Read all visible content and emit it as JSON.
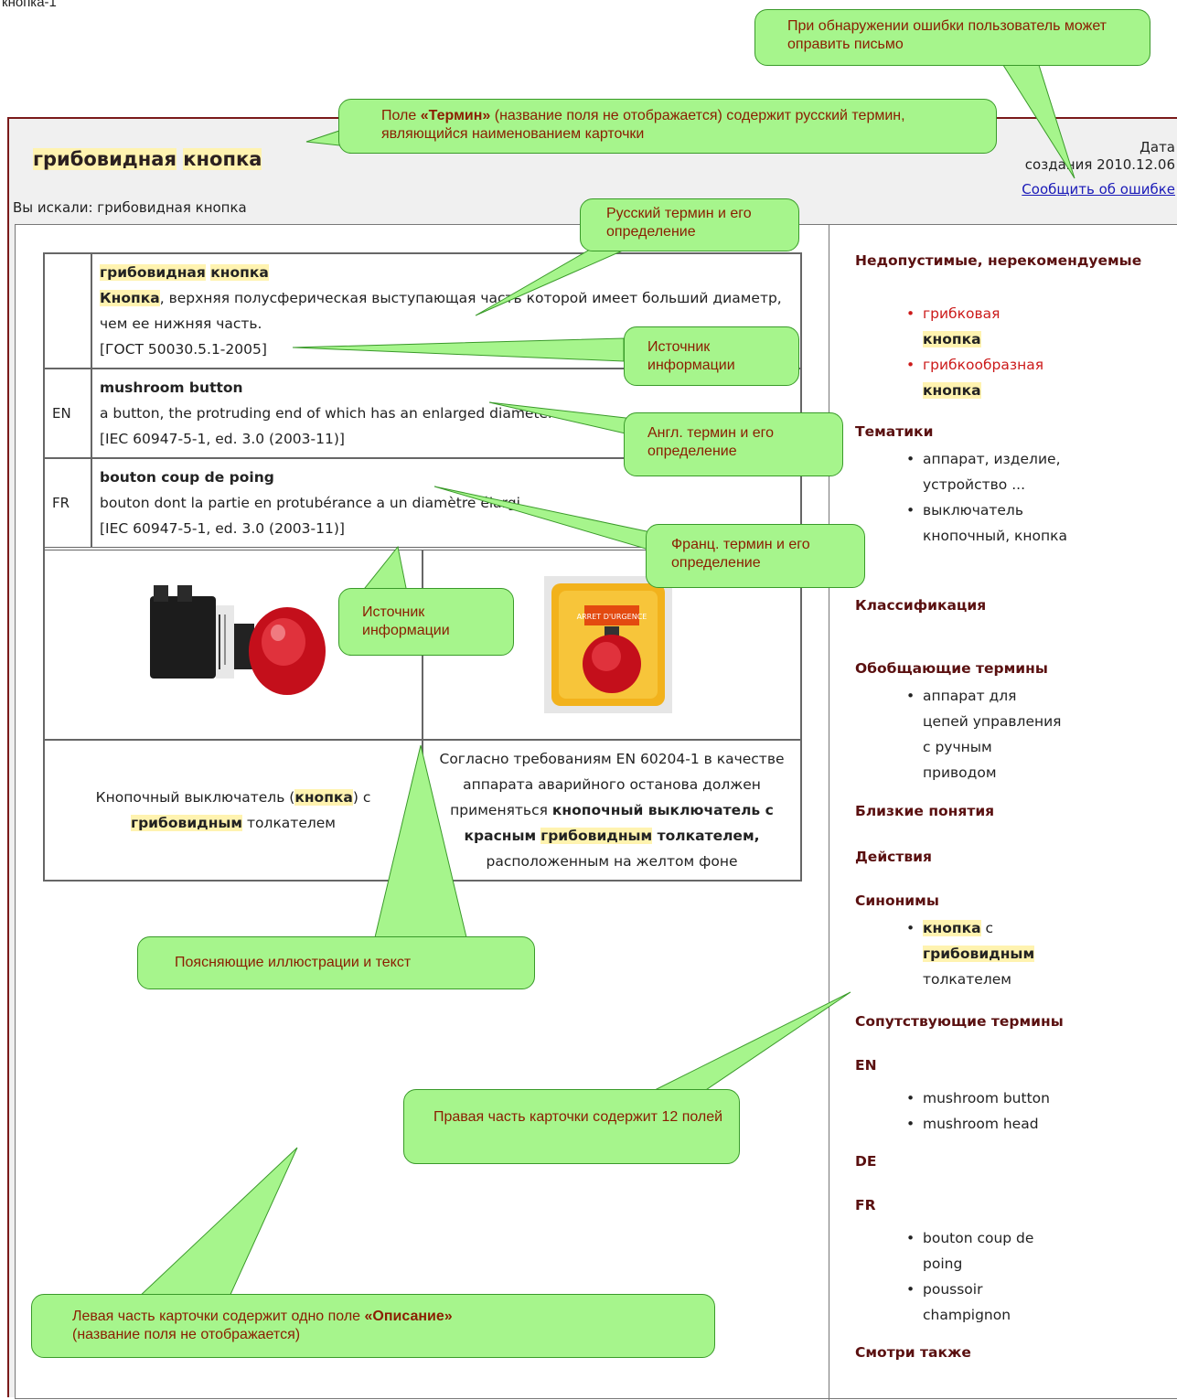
{
  "caption": "кнопка-1",
  "card": {
    "title_part1": "грибовидная",
    "title_part2": "кнопка",
    "date_label": "Дата",
    "date_value": "создания 2010.12.06",
    "report_link": "Сообщить об ошибке",
    "searched": "Вы искали: грибовидная кнопка"
  },
  "definitions": [
    {
      "lang": "",
      "term_a": "грибовидная",
      "term_b": "кнопка",
      "def_bold": "Кнопка",
      "def_rest": ", верхняя полусферическая выступающая часть которой имеет больший диаметр, чем ее нижняя часть.",
      "source": "[ГОСТ 50030.5.1-2005]"
    },
    {
      "lang": "EN",
      "term": "mushroom button",
      "definition": "a button, the protruding end of which has an enlarged diameter",
      "source": "[IEC 60947-5-1, ed. 3.0 (2003-11)]"
    },
    {
      "lang": "FR",
      "term": "bouton coup de poing",
      "definition": "bouton dont la partie en protubérance a un diamètre élargi",
      "source": "[IEC 60947-5-1, ed. 3.0 (2003-11)]"
    }
  ],
  "images": {
    "left_label": "",
    "right_label": "ARRET D'URGENCE"
  },
  "illustration_texts": {
    "left": {
      "p1": "Кнопочный выключатель (",
      "hl1": "кнопка",
      "p2": ") с",
      "hl2": "грибовидным",
      "p3": " толкателем"
    },
    "right": {
      "p1": "Согласно требованиям EN 60204-1 в качестве аппарата аварийного останова должен применяться",
      "b1": "кнопочный выключатель с красным",
      "hl": "грибовидным",
      "b2": " толкателем,",
      "p2": "расположенным на желтом фоне"
    }
  },
  "right_panel": {
    "inadmissible_head": "Недопустимые, нерекомендуемые",
    "inadmissible": [
      {
        "a": "грибковая",
        "b": "кнопка"
      },
      {
        "a": "грибкообразная",
        "b": "кнопка"
      }
    ],
    "topics_head": "Тематики",
    "topics": [
      "аппарат, изделие, устройство ...",
      "выключатель кнопочный, кнопка"
    ],
    "classification_head": "Классификация",
    "generic_head": "Обобщающие термины",
    "generic": [
      "аппарат для цепей управления с ручным приводом"
    ],
    "close_head": "Близкие понятия",
    "actions_head": "Действия",
    "synonyms_head": "Синонимы",
    "synonym": {
      "a": "кнопка",
      "b": " с",
      "c": "грибовидным",
      "d": "толкателем"
    },
    "related_head": "Сопутствующие термины",
    "en_head": "EN",
    "en": [
      "mushroom button",
      "mushroom head"
    ],
    "de_head": "DE",
    "fr_head": "FR",
    "fr": [
      "bouton coup de poing",
      "poussoir champignon"
    ],
    "see_also_head": "Смотри также"
  },
  "callouts": {
    "error_note": "При обнаружении ошибки пользователь может оправить письмо",
    "term_field_pre": "Поле ",
    "term_field_bold": "«Термин»",
    "term_field_post": " (название поля не отображается) содержит русский термин, являющийся наименованием карточки",
    "ru_def": "Русский термин и его определение",
    "source1": "Источник информации",
    "en_def": "Англ. термин и его определение",
    "fr_def": "Франц. термин и его определение",
    "source2": "Источник информации",
    "illustrations": "Поясняющие иллюстрации и текст",
    "right_part": "Правая часть карточки содержит 12 полей",
    "left_part_pre": "Левая часть карточки содержит одно поле ",
    "left_part_bold": "«Описание»",
    "left_part_post": "(название поля не отображается)"
  },
  "colors": {
    "callout_fill": "#a6f58c",
    "callout_text": "#8b1e00",
    "heading": "#5a1010",
    "highlight": "#fff3b0",
    "link": "#1a1ab8",
    "red_item": "#cc1a1a",
    "card_border": "#7a1a1a"
  }
}
